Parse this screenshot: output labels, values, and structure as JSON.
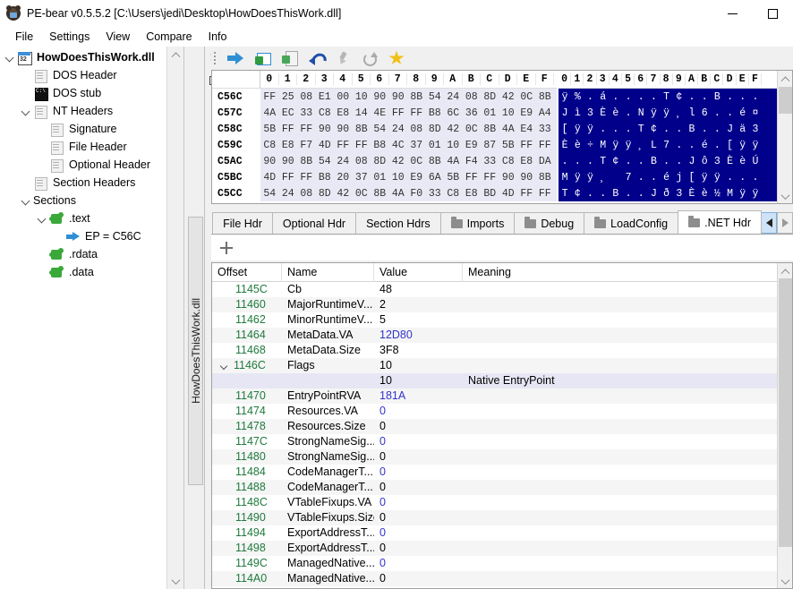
{
  "window": {
    "title": "PE-bear v0.5.5.2 [C:\\Users\\jedi\\Desktop\\HowDoesThisWork.dll]",
    "app_icon": "bear-icon",
    "minimize_label": "",
    "maximize_label": ""
  },
  "menubar": {
    "items": [
      {
        "label": "File"
      },
      {
        "label": "Settings"
      },
      {
        "label": "View"
      },
      {
        "label": "Compare"
      },
      {
        "label": "Info"
      }
    ]
  },
  "sidebar": {
    "tree": [
      {
        "label": "HowDoesThisWork.dll",
        "icon": "window-32-icon",
        "indent": 0,
        "chevron": "open",
        "bold": true
      },
      {
        "label": "DOS Header",
        "icon": "document-icon",
        "indent": 1,
        "chevron": "none",
        "bold": false
      },
      {
        "label": "DOS stub",
        "icon": "terminal-icon",
        "indent": 1,
        "chevron": "none",
        "bold": false
      },
      {
        "label": "NT Headers",
        "icon": "document-icon",
        "indent": 1,
        "chevron": "open",
        "bold": false
      },
      {
        "label": "Signature",
        "icon": "document-icon",
        "indent": 2,
        "chevron": "none",
        "bold": false
      },
      {
        "label": "File Header",
        "icon": "document-icon",
        "indent": 2,
        "chevron": "none",
        "bold": false
      },
      {
        "label": "Optional Header",
        "icon": "document-icon",
        "indent": 2,
        "chevron": "none",
        "bold": false
      },
      {
        "label": "Section Headers",
        "icon": "document-icon",
        "indent": 1,
        "chevron": "none",
        "bold": false
      },
      {
        "label": "Sections",
        "icon": "none",
        "indent": 1,
        "chevron": "open",
        "bold": false
      },
      {
        "label": ".text",
        "icon": "puzzle-icon",
        "indent": 2,
        "chevron": "open",
        "bold": false
      },
      {
        "label": "EP = C56C",
        "icon": "blue-arrow-icon",
        "indent": 3,
        "chevron": "none",
        "bold": false
      },
      {
        "label": ".rdata",
        "icon": "puzzle-icon",
        "indent": 2,
        "chevron": "none",
        "bold": false
      },
      {
        "label": ".data",
        "icon": "puzzle-icon",
        "indent": 2,
        "chevron": "none",
        "bold": false
      }
    ]
  },
  "doc_tab": {
    "label": "HowDoesThisWork.dll"
  },
  "panel_tools": {
    "close_label": "✕",
    "restore_name": "restore-icon"
  },
  "toolbar": {
    "buttons": [
      {
        "name": "goto-address-icon",
        "label": ""
      },
      {
        "name": "new-window-icon",
        "label": ""
      },
      {
        "name": "export-document-icon",
        "label": ""
      },
      {
        "name": "undo-icon",
        "label": ""
      },
      {
        "name": "pin-icon",
        "label": ""
      },
      {
        "name": "refresh-icon",
        "label": ""
      },
      {
        "name": "favorite-star-icon",
        "label": ""
      }
    ]
  },
  "hex_view": {
    "column_headers": [
      "0",
      "1",
      "2",
      "3",
      "4",
      "5",
      "6",
      "7",
      "8",
      "9",
      "A",
      "B",
      "C",
      "D",
      "E",
      "F"
    ],
    "rows": [
      {
        "offset": "C56C",
        "bytes": [
          "FF",
          "25",
          "08",
          "E1",
          "00",
          "10",
          "90",
          "90",
          "8B",
          "54",
          "24",
          "08",
          "8D",
          "42",
          "0C",
          "8B"
        ],
        "ascii": [
          "ÿ",
          "%",
          ".",
          "á",
          ".",
          ".",
          ".",
          ".",
          "T",
          "¢",
          ".",
          ".",
          "B",
          ".",
          ".",
          "."
        ]
      },
      {
        "offset": "C57C",
        "bytes": [
          "4A",
          "EC",
          "33",
          "C8",
          "E8",
          "14",
          "4E",
          "FF",
          "FF",
          "B8",
          "6C",
          "36",
          "01",
          "10",
          "E9",
          "A4"
        ],
        "ascii": [
          "J",
          "ì",
          "3",
          "È",
          "è",
          ".",
          "N",
          "ÿ",
          "ÿ",
          "¸",
          "l",
          "6",
          ".",
          ".",
          "é",
          "¤"
        ]
      },
      {
        "offset": "C58C",
        "bytes": [
          "5B",
          "FF",
          "FF",
          "90",
          "90",
          "8B",
          "54",
          "24",
          "08",
          "8D",
          "42",
          "0C",
          "8B",
          "4A",
          "E4",
          "33"
        ],
        "ascii": [
          "[",
          "ÿ",
          "ÿ",
          ".",
          ".",
          ".",
          "T",
          "¢",
          ".",
          ".",
          "B",
          ".",
          ".",
          "J",
          "ä",
          "3"
        ]
      },
      {
        "offset": "C59C",
        "bytes": [
          "C8",
          "E8",
          "F7",
          "4D",
          "FF",
          "FF",
          "B8",
          "4C",
          "37",
          "01",
          "10",
          "E9",
          "87",
          "5B",
          "FF",
          "FF"
        ],
        "ascii": [
          "È",
          "è",
          "÷",
          "M",
          "ÿ",
          "ÿ",
          "¸",
          "L",
          "7",
          ".",
          ".",
          "é",
          ".",
          "[",
          "ÿ",
          "ÿ"
        ]
      },
      {
        "offset": "C5AC",
        "bytes": [
          "90",
          "90",
          "8B",
          "54",
          "24",
          "08",
          "8D",
          "42",
          "0C",
          "8B",
          "4A",
          "F4",
          "33",
          "C8",
          "E8",
          "DA"
        ],
        "ascii": [
          ".",
          ".",
          ".",
          "T",
          "¢",
          ".",
          ".",
          "B",
          ".",
          ".",
          "J",
          "ô",
          "3",
          "È",
          "è",
          "Ú"
        ]
      },
      {
        "offset": "C5BC",
        "bytes": [
          "4D",
          "FF",
          "FF",
          "B8",
          "20",
          "37",
          "01",
          "10",
          "E9",
          "6A",
          "5B",
          "FF",
          "FF",
          "90",
          "90",
          "8B"
        ],
        "ascii": [
          "M",
          "ÿ",
          "ÿ",
          "¸",
          " ",
          "7",
          ".",
          ".",
          "é",
          "j",
          "[",
          "ÿ",
          "ÿ",
          ".",
          ".",
          "."
        ]
      },
      {
        "offset": "C5CC",
        "bytes": [
          "54",
          "24",
          "08",
          "8D",
          "42",
          "0C",
          "8B",
          "4A",
          "F0",
          "33",
          "C8",
          "E8",
          "BD",
          "4D",
          "FF",
          "FF"
        ],
        "ascii": [
          "T",
          "¢",
          ".",
          ".",
          "B",
          ".",
          ".",
          "J",
          "ð",
          "3",
          "È",
          "è",
          "½",
          "M",
          "ÿ",
          "ÿ"
        ]
      }
    ]
  },
  "tabs": {
    "items": [
      {
        "label": "File Hdr",
        "icon": "none",
        "active": false
      },
      {
        "label": "Optional Hdr",
        "icon": "none",
        "active": false
      },
      {
        "label": "Section Hdrs",
        "icon": "none",
        "active": false
      },
      {
        "label": "Imports",
        "icon": "folder-icon",
        "active": false
      },
      {
        "label": "Debug",
        "icon": "folder-icon",
        "active": false
      },
      {
        "label": "LoadConfig",
        "icon": "folder-icon",
        "active": false
      },
      {
        "label": ".NET Hdr",
        "icon": "folder-icon",
        "active": true
      }
    ],
    "nav_prev": "tab-scroll-left",
    "nav_next": "tab-scroll-right"
  },
  "table": {
    "columns": [
      "Offset",
      "Name",
      "Value",
      "Meaning"
    ],
    "rows": [
      {
        "offset": "1145C",
        "name": "Cb",
        "value": "48",
        "meaning": "",
        "value_blue": false,
        "expandable": false,
        "highlight": false
      },
      {
        "offset": "11460",
        "name": "MajorRuntimeV...",
        "value": "2",
        "meaning": "",
        "value_blue": false,
        "expandable": false,
        "highlight": false
      },
      {
        "offset": "11462",
        "name": "MinorRuntimeV...",
        "value": "5",
        "meaning": "",
        "value_blue": false,
        "expandable": false,
        "highlight": false
      },
      {
        "offset": "11464",
        "name": "MetaData.VA",
        "value": "12D80",
        "meaning": "",
        "value_blue": true,
        "expandable": false,
        "highlight": false
      },
      {
        "offset": "11468",
        "name": "MetaData.Size",
        "value": "3F8",
        "meaning": "",
        "value_blue": false,
        "expandable": false,
        "highlight": false
      },
      {
        "offset": "1146C",
        "name": "Flags",
        "value": "10",
        "meaning": "",
        "value_blue": false,
        "expandable": true,
        "highlight": false
      },
      {
        "offset": "",
        "name": "",
        "value": "10",
        "meaning": "Native EntryPoint",
        "value_blue": false,
        "expandable": false,
        "highlight": true
      },
      {
        "offset": "11470",
        "name": "EntryPointRVA",
        "value": "181A",
        "meaning": "",
        "value_blue": true,
        "expandable": false,
        "highlight": false
      },
      {
        "offset": "11474",
        "name": "Resources.VA",
        "value": "0",
        "meaning": "",
        "value_blue": true,
        "expandable": false,
        "highlight": false
      },
      {
        "offset": "11478",
        "name": "Resources.Size",
        "value": "0",
        "meaning": "",
        "value_blue": false,
        "expandable": false,
        "highlight": false
      },
      {
        "offset": "1147C",
        "name": "StrongNameSig...",
        "value": "0",
        "meaning": "",
        "value_blue": true,
        "expandable": false,
        "highlight": false
      },
      {
        "offset": "11480",
        "name": "StrongNameSig...",
        "value": "0",
        "meaning": "",
        "value_blue": false,
        "expandable": false,
        "highlight": false
      },
      {
        "offset": "11484",
        "name": "CodeManagerT...",
        "value": "0",
        "meaning": "",
        "value_blue": true,
        "expandable": false,
        "highlight": false
      },
      {
        "offset": "11488",
        "name": "CodeManagerT...",
        "value": "0",
        "meaning": "",
        "value_blue": false,
        "expandable": false,
        "highlight": false
      },
      {
        "offset": "1148C",
        "name": "VTableFixups.VA",
        "value": "0",
        "meaning": "",
        "value_blue": true,
        "expandable": false,
        "highlight": false
      },
      {
        "offset": "11490",
        "name": "VTableFixups.Size",
        "value": "0",
        "meaning": "",
        "value_blue": false,
        "expandable": false,
        "highlight": false
      },
      {
        "offset": "11494",
        "name": "ExportAddressT...",
        "value": "0",
        "meaning": "",
        "value_blue": true,
        "expandable": false,
        "highlight": false
      },
      {
        "offset": "11498",
        "name": "ExportAddressT...",
        "value": "0",
        "meaning": "",
        "value_blue": false,
        "expandable": false,
        "highlight": false
      },
      {
        "offset": "1149C",
        "name": "ManagedNative...",
        "value": "0",
        "meaning": "",
        "value_blue": true,
        "expandable": false,
        "highlight": false
      },
      {
        "offset": "114A0",
        "name": "ManagedNative...",
        "value": "0",
        "meaning": "",
        "value_blue": false,
        "expandable": false,
        "highlight": false
      }
    ]
  },
  "colors": {
    "offset_green": "#1f7a3d",
    "value_blue": "#3333cc",
    "ascii_bg": "#00008b",
    "hex_bg": "#e9e9f5",
    "highlight_row": "#e6e6f5"
  }
}
